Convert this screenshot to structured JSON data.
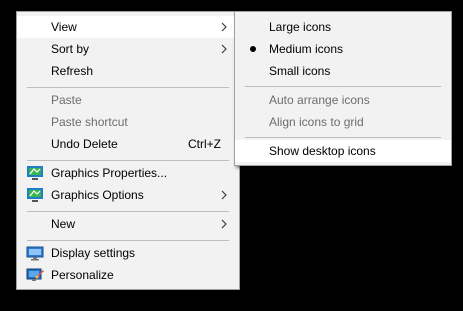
{
  "main_menu": {
    "view": "View",
    "sort_by": "Sort by",
    "refresh": "Refresh",
    "paste": "Paste",
    "paste_shortcut": "Paste shortcut",
    "undo_delete": "Undo Delete",
    "undo_delete_shortcut": "Ctrl+Z",
    "graphics_properties": "Graphics Properties...",
    "graphics_options": "Graphics Options",
    "new": "New",
    "display_settings": "Display settings",
    "personalize": "Personalize"
  },
  "view_submenu": {
    "large_icons": "Large icons",
    "medium_icons": "Medium icons",
    "small_icons": "Small icons",
    "auto_arrange_icons": "Auto arrange icons",
    "align_icons_to_grid": "Align icons to grid",
    "show_desktop_icons": "Show desktop icons",
    "selected": "medium_icons"
  },
  "icons": {
    "graphics_properties": "intel-graphics-icon",
    "graphics_options": "intel-graphics-icon",
    "display_settings": "monitor-icon",
    "personalize": "personalize-icon",
    "submenu": "chevron-right-icon",
    "selected_marker": "bullet-icon"
  },
  "colors": {
    "desktop": "#000000",
    "menu_bg": "#f2f2f2",
    "hover_bg": "#ffffff",
    "disabled_text": "#6d6d6d"
  }
}
